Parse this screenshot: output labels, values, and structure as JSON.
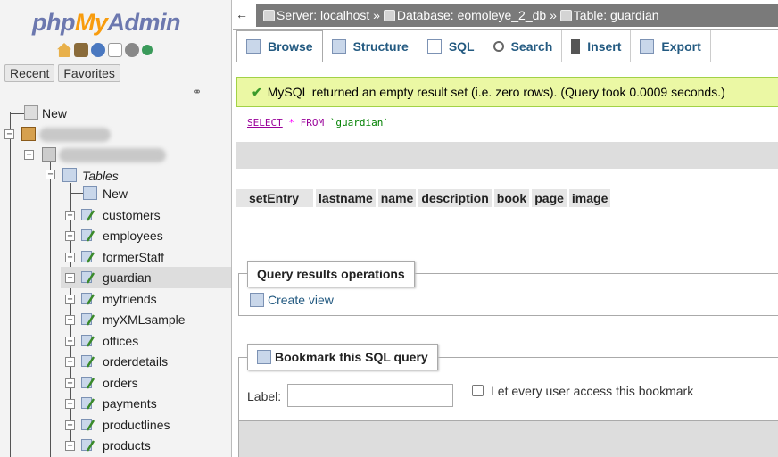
{
  "brand": {
    "part1": "php",
    "part2": "My",
    "part3": "Admin"
  },
  "nav": {
    "icons": [
      "home-icon",
      "exit-icon",
      "help-icon",
      "docs-icon",
      "settings-icon",
      "reload-icon"
    ],
    "tabs": {
      "recent": "Recent",
      "favorites": "Favorites"
    },
    "new_server": "New",
    "tables_label": "Tables",
    "tables_new": "New",
    "tables": [
      "customers",
      "employees",
      "formerStaff",
      "guardian",
      "myfriends",
      "myXMLsample",
      "offices",
      "orderdetails",
      "orders",
      "payments",
      "productlines",
      "products"
    ],
    "selected_table": "guardian"
  },
  "breadcrumb": {
    "server": "Server: localhost",
    "sep1": "»",
    "database": "Database: eomoleye_2_db",
    "sep2": "»",
    "table": "Table: guardian"
  },
  "tabs": [
    {
      "label": "Browse",
      "icon": "browse-icon"
    },
    {
      "label": "Structure",
      "icon": "structure-icon"
    },
    {
      "label": "SQL",
      "icon": "sql-icon"
    },
    {
      "label": "Search",
      "icon": "search-icon"
    },
    {
      "label": "Insert",
      "icon": "insert-icon"
    },
    {
      "label": "Export",
      "icon": "export-icon"
    }
  ],
  "message": "MySQL returned an empty result set (i.e. zero rows). (Query took 0.0009 seconds.)",
  "sql": {
    "select": "SELECT",
    "star": "*",
    "from": "FROM",
    "table": "`guardian`"
  },
  "columns": [
    "setEntry",
    "lastname",
    "name",
    "description",
    "book",
    "page",
    "image"
  ],
  "query_ops": {
    "legend": "Query results operations",
    "create_view": "Create view"
  },
  "bookmark": {
    "legend": "Bookmark this SQL query",
    "label": "Label:",
    "label_value": "",
    "checkbox_label": "Let every user access this bookmark",
    "checked": false
  },
  "colors": {
    "accent": "#235a81",
    "success_bg": "#ebf8a4",
    "logo_blue": "#6c78af",
    "logo_orange": "#f89c0e"
  }
}
